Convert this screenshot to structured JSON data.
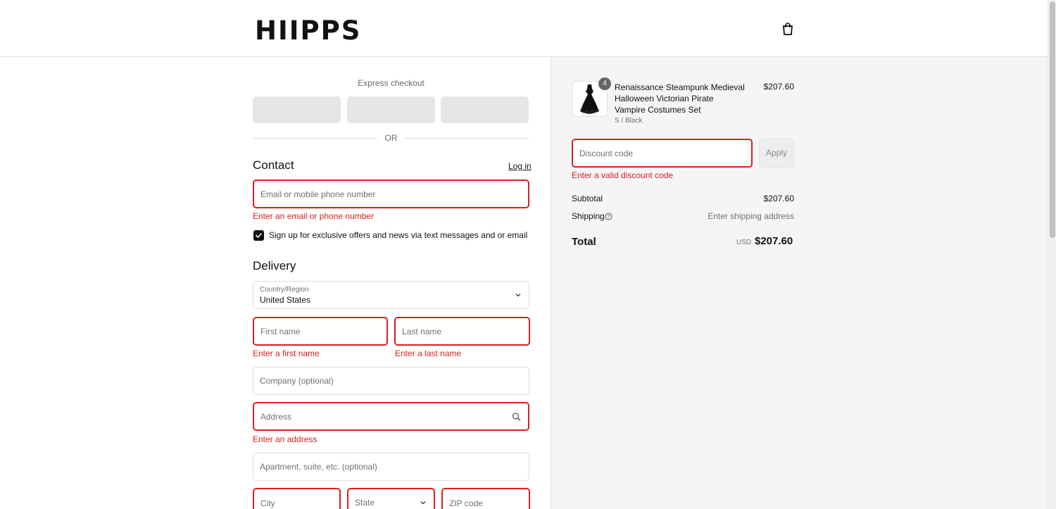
{
  "brand": {
    "logo_text": "HIIPPS"
  },
  "header": {
    "cart_icon": "shopping-bag-icon"
  },
  "express": {
    "title": "Express checkout",
    "divider": "OR"
  },
  "contact": {
    "title": "Contact",
    "login_label": "Log in",
    "email_placeholder": "Email or mobile phone number",
    "email_error": "Enter an email or phone number",
    "marketing_label": "Sign up for exclusive offers and news via text messages and or email",
    "marketing_checked": true
  },
  "delivery": {
    "title": "Delivery",
    "country_label": "Country/Region",
    "country_value": "United States",
    "first_name_placeholder": "First name",
    "first_name_error": "Enter a first name",
    "last_name_placeholder": "Last name",
    "last_name_error": "Enter a last name",
    "company_placeholder": "Company (optional)",
    "address_placeholder": "Address",
    "address_error": "Enter an address",
    "apartment_placeholder": "Apartment, suite, etc. (optional)",
    "city_placeholder": "City",
    "state_placeholder": "State",
    "zip_placeholder": "ZIP code"
  },
  "summary": {
    "product": {
      "quantity": "4",
      "title": "Renaissance Steampunk Medieval Halloween Victorian Pirate Vampire Costumes Set",
      "variant": "S / Black",
      "price": "$207.60"
    },
    "discount": {
      "placeholder": "Discount code",
      "apply_label": "Apply",
      "error": "Enter a valid discount code"
    },
    "subtotal_label": "Subtotal",
    "subtotal_value": "$207.60",
    "shipping_label": "Shipping",
    "shipping_value": "Enter shipping address",
    "total_label": "Total",
    "total_currency": "USD",
    "total_value": "$207.60"
  },
  "colors": {
    "error": "#dd1d1d",
    "summary_bg": "#f5f5f5",
    "express_button_bg": "#e6e6e6"
  }
}
